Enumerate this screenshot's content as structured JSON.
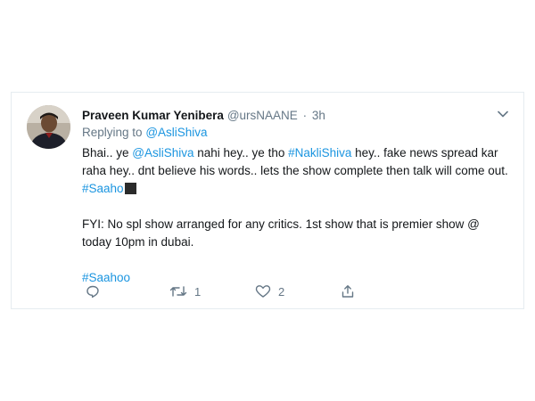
{
  "tweet": {
    "display_name": "Praveen Kumar Yenibera",
    "handle": "@ursNAANE",
    "separator": "·",
    "time": "3h",
    "replying_prefix": "Replying to",
    "replying_to": "@AsliShiva",
    "body": {
      "p1_a": "Bhai.. ye ",
      "p1_mention": "@AsliShiva",
      "p1_b": " nahi hey.. ye tho ",
      "p1_hashtag": "#NakliShiva",
      "p1_c": " hey.. fake news spread kar raha hey.. dnt believe his words.. lets the show complete then talk will come out. ",
      "p1_hashtag2": "#Saaho",
      "p2": "FYI: No spl show arranged for any critics. 1st show that is premier show @ today 10pm in dubai.",
      "p3_hashtag": "#Saahoo"
    },
    "actions": {
      "reply_count": "",
      "retweet_count": "1",
      "like_count": "2"
    },
    "icons": {
      "more": "chevron-down-icon",
      "reply": "reply-icon",
      "retweet": "retweet-icon",
      "like": "heart-icon",
      "share": "share-icon"
    },
    "colors": {
      "link": "#1b95e0",
      "muted": "#657786",
      "text": "#14171a",
      "border": "#e6ecf0"
    }
  }
}
